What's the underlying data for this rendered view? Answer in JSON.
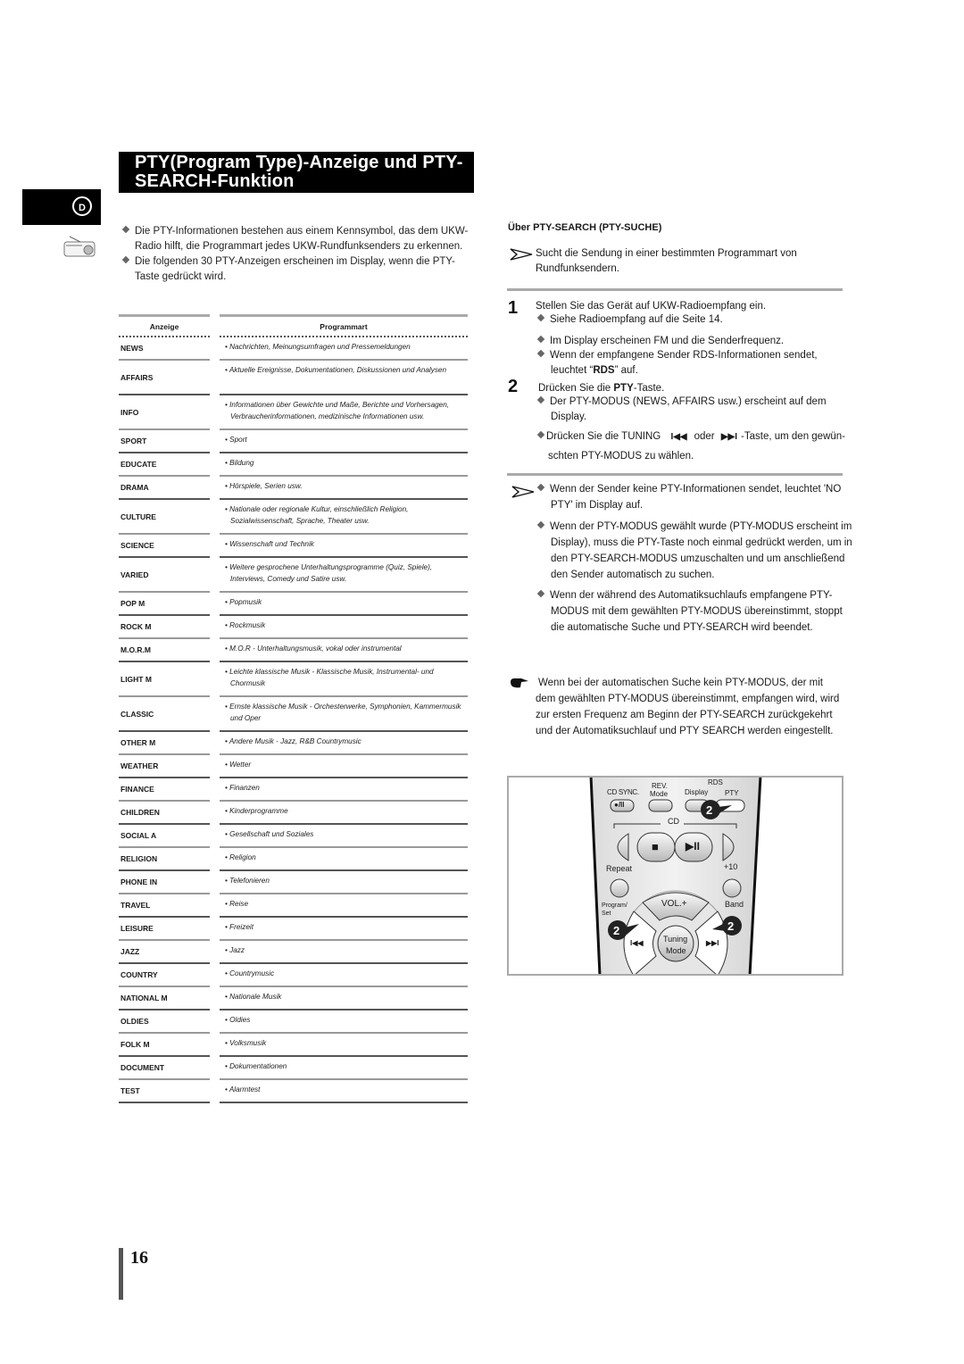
{
  "title": "PTY(Program Type)-Anzeige und PTY- SEARCH-Funktion",
  "title_lines": [
    "PTY(Program Type)-Anzeige und PTY-",
    "SEARCH-Funktion"
  ],
  "language_tab": "D",
  "icons": {
    "language": "circle-d-icon",
    "section": "radio-icon",
    "note_arrow": "arrow-pointer-icon",
    "hand": "pointing-hand-icon",
    "bullet": "diamond-bullet-icon"
  },
  "intro": [
    "Die PTY-Informationen bestehen aus einem Kennsymbol, das dem UKW-Radio hilft, die Programmart jedes UKW-Rundfunksenders zu erkennen.",
    "Die folgenden 30 PTY-Anzeigen erscheinen im Display, wenn die PTY-Taste gedrückt wird."
  ],
  "table": {
    "headers": [
      "Anzeige",
      "Programmart"
    ],
    "rows": [
      {
        "code": "NEWS",
        "desc": "• Nachrichten, Meinungsumfragen und Pressemeldungen"
      },
      {
        "code": "AFFAIRS",
        "desc": "• Aktuelle Ereignisse, Dokumentationen, Diskussionen und Analysen"
      },
      {
        "code": "INFO",
        "desc": "• Informationen über Gewichte und Maße, Berichte und Vorhersagen, Verbraucherinformationen, medizinische Informationen usw."
      },
      {
        "code": "SPORT",
        "desc": "• Sport"
      },
      {
        "code": "EDUCATE",
        "desc": "• Bildung"
      },
      {
        "code": "DRAMA",
        "desc": "• Hörspiele, Serien usw."
      },
      {
        "code": "CULTURE",
        "desc": "• Nationale oder regionale Kultur, einschließlich Religion, Sozialwissenschaft, Sprache, Theater usw."
      },
      {
        "code": "SCIENCE",
        "desc": "• Wissenschaft und Technik"
      },
      {
        "code": "VARIED",
        "desc": "• Weitere gesprochene Unterhaltungsprogramme (Quiz, Spiele), Interviews, Comedy und Satire usw."
      },
      {
        "code": "POP M",
        "desc": "• Popmusik"
      },
      {
        "code": "ROCK M",
        "desc": "• Rockmusik"
      },
      {
        "code": "M.O.R.M",
        "desc": "• M.O.R - Unterhaltungsmusik, vokal oder instrumental"
      },
      {
        "code": "LIGHT M",
        "desc": "• Leichte klassische Musik - Klassische Musik, Instrumental- und Chormusik"
      },
      {
        "code": "CLASSIC",
        "desc": "• Ernste klassische Musik - Orchesterwerke, Symphonien, Kammermusik und Oper"
      },
      {
        "code": "OTHER M",
        "desc": "• Andere Musik - Jazz, R&B Countrymusic"
      },
      {
        "code": "WEATHER",
        "desc": "• Wetter"
      },
      {
        "code": "FINANCE",
        "desc": "• Finanzen"
      },
      {
        "code": "CHILDREN",
        "desc": "• Kinderprogramme"
      },
      {
        "code": "SOCIAL  A",
        "desc": "• Gesellschaft und Soziales"
      },
      {
        "code": "RELIGION",
        "desc": "• Religion"
      },
      {
        "code": "PHONE IN",
        "desc": "• Telefonieren"
      },
      {
        "code": "TRAVEL",
        "desc": "• Reise"
      },
      {
        "code": "LEISURE",
        "desc": "• Freizeit"
      },
      {
        "code": "JAZZ",
        "desc": "• Jazz"
      },
      {
        "code": "COUNTRY",
        "desc": "• Countrymusic"
      },
      {
        "code": "NATIONAL M",
        "desc": "• Nationale Musik"
      },
      {
        "code": "OLDIES",
        "desc": "• Oldies"
      },
      {
        "code": "FOLK M",
        "desc": "• Volksmusik"
      },
      {
        "code": "DOCUMENT",
        "desc": "• Dokumentationen"
      },
      {
        "code": "TEST",
        "desc": "• Alarmtest"
      }
    ]
  },
  "right": {
    "heading": "Über PTY-SEARCH (PTY-SUCHE)",
    "intro_note": "Sucht die Sendung in einer bestimmten Programmart von Rundfunksendern.",
    "step1": {
      "num": "1",
      "text": "Stellen Sie das Gerät auf UKW-Radioempfang ein.",
      "bullets": [
        "Siehe Radioempfang auf die Seite 14.",
        "Im Display erscheinen FM und die Senderfrequenz.",
        "Wenn der empfangene Sender RDS-Informationen sendet, leuchtet “RDS” auf."
      ]
    },
    "step2": {
      "num": "2",
      "text_pre": "Drücken Sie die ",
      "text_bold": "PTY",
      "text_post": "-Taste.",
      "bullets": [
        "Der PTY-MODUS (NEWS, AFFAIRS usw.) erscheint auf dem Display."
      ],
      "tuning_pre": "Drücken Sie die TUNING",
      "tuning_mid": "oder",
      "tuning_post": "-Taste, um den gewün-",
      "tuning_line2": "schten PTY-MODUS zu wählen."
    },
    "notes": [
      "Wenn der Sender keine PTY-Informationen sendet, leuchtet 'NO PTY' im Display auf.",
      "Wenn der PTY-MODUS gewählt wurde (PTY-MODUS erscheint im Display), muss die PTY-Taste noch einmal gedrückt werden, um in den PTY-SEARCH-MODUS umzuschalten und um anschließend den Sender automatisch zu suchen.",
      "Wenn der während des Automatiksuchlaufs empfangene PTY-MODUS mit dem gewählten PTY-MODUS übereinstimmt, stoppt die automatische Suche und PTY-SEARCH wird beendet."
    ],
    "hand_note": "Wenn bei der automatischen Suche kein PTY-MODUS, der mit dem gewählten PTY-MODUS übereinstimmt, empfangen wird, wird zur ersten Frequenz am Beginn der PTY-SEARCH zurückgekehrt und der Automatiksuchlauf und PTY SEARCH werden eingestellt."
  },
  "remote": {
    "labels": {
      "cd_sync": "CD SYNC.",
      "rev": "REV.",
      "mode": "Mode",
      "rds": "RDS",
      "display": "Display",
      "pty": "PTY",
      "cd": "CD",
      "repeat": "Repeat",
      "plus10": "+10",
      "program": "Program/",
      "set": "Set",
      "band": "Band",
      "vol": "VOL.+",
      "tuning": "Tuning",
      "tuning_mode": "Mode",
      "rec_pause": "●/II",
      "stop": "■",
      "play_pause": "▶II",
      "prev": "I◀◀",
      "next": "▶▶I"
    },
    "step_markers": [
      "2",
      "2",
      "2"
    ]
  },
  "page_number": "16"
}
